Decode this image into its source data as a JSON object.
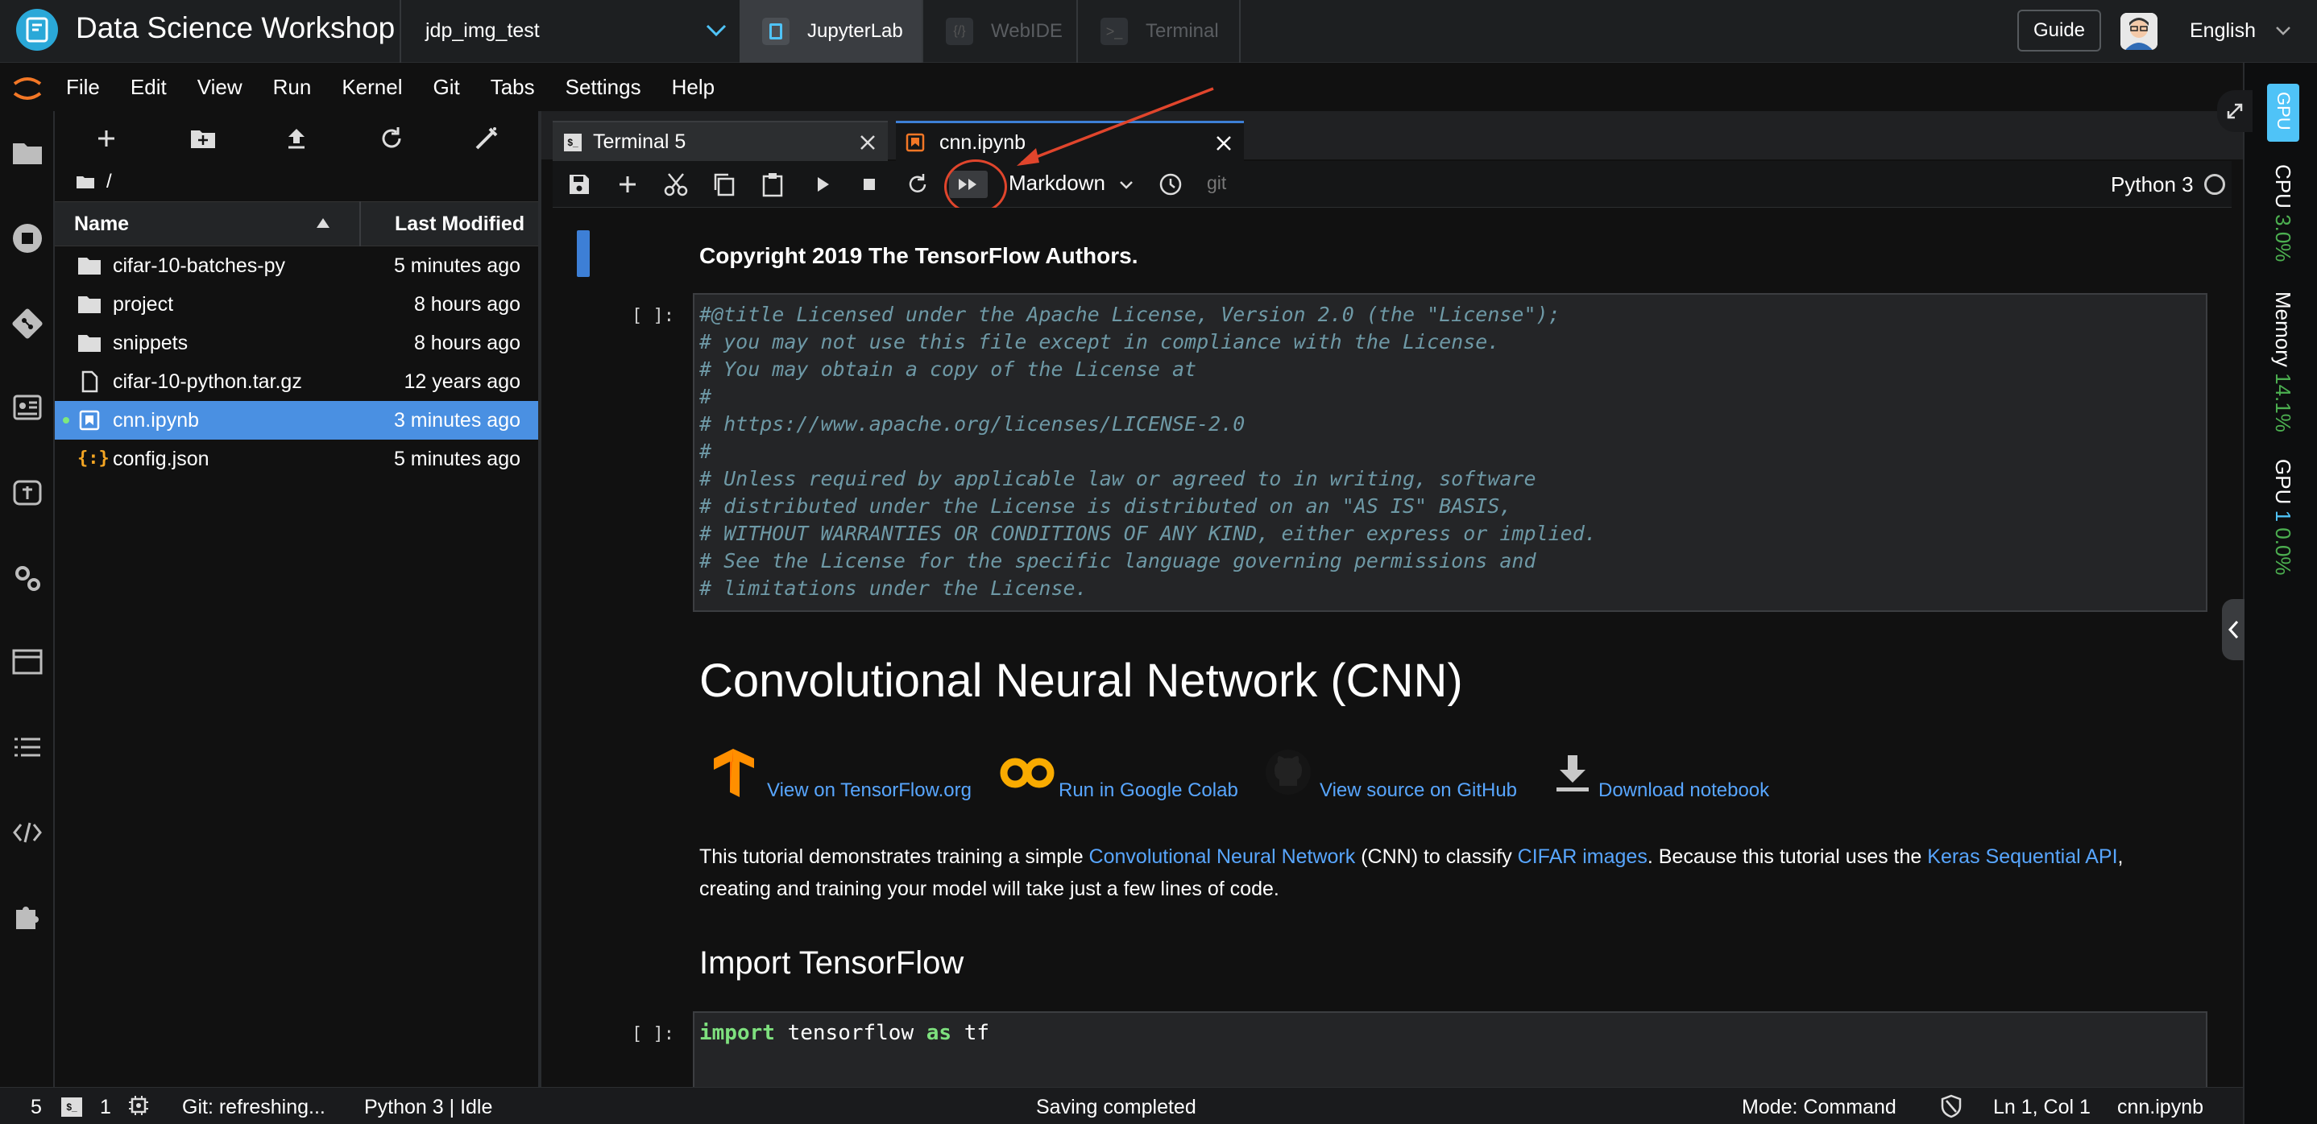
{
  "header": {
    "app_title": "Data Science Workshop",
    "project_name": "jdp_img_test",
    "app_tabs": [
      {
        "label": "JupyterLab",
        "active": true
      },
      {
        "label": "WebIDE",
        "active": false
      },
      {
        "label": "Terminal",
        "active": false
      }
    ],
    "guide_label": "Guide",
    "language": "English"
  },
  "menu": [
    "File",
    "Edit",
    "View",
    "Run",
    "Kernel",
    "Git",
    "Tabs",
    "Settings",
    "Help"
  ],
  "file_browser": {
    "breadcrumb": "/",
    "col_name": "Name",
    "col_modified": "Last Modified",
    "files": [
      {
        "name": "cifar-10-batches-py",
        "modified": "5 minutes ago",
        "icon": "folder-icon",
        "selected": false
      },
      {
        "name": "project",
        "modified": "8 hours ago",
        "icon": "folder-icon",
        "selected": false
      },
      {
        "name": "snippets",
        "modified": "8 hours ago",
        "icon": "folder-icon",
        "selected": false
      },
      {
        "name": "cifar-10-python.tar.gz",
        "modified": "12 years ago",
        "icon": "file-icon",
        "selected": false
      },
      {
        "name": "cnn.ipynb",
        "modified": "3 minutes ago",
        "icon": "notebook-icon",
        "selected": true
      },
      {
        "name": "config.json",
        "modified": "5 minutes ago",
        "icon": "json-icon",
        "selected": false
      }
    ]
  },
  "doc_tabs": [
    {
      "label": "Terminal 5",
      "active": false
    },
    {
      "label": "cnn.ipynb",
      "active": true
    }
  ],
  "toolbar": {
    "cell_type": "Markdown",
    "git_label": "git",
    "kernel_name": "Python 3"
  },
  "notebook": {
    "copyright": "Copyright 2019 The TensorFlow Authors.",
    "prompt": "[ ]:",
    "license_lines": [
      "#@title Licensed under the Apache License, Version 2.0 (the \"License\");",
      "# you may not use this file except in compliance with the License.",
      "# You may obtain a copy of the License at",
      "#",
      "# https://www.apache.org/licenses/LICENSE-2.0",
      "#",
      "# Unless required by applicable law or agreed to in writing, software",
      "# distributed under the License is distributed on an \"AS IS\" BASIS,",
      "# WITHOUT WARRANTIES OR CONDITIONS OF ANY KIND, either express or implied.",
      "# See the License for the specific language governing permissions and",
      "# limitations under the License."
    ],
    "h1": "Convolutional Neural Network (CNN)",
    "links": {
      "tf": "View on TensorFlow.org",
      "colab": "Run in Google Colab",
      "github": "View source on GitHub",
      "download": "Download notebook"
    },
    "para": {
      "t1": "This tutorial demonstrates training a simple ",
      "l1": "Convolutional Neural Network",
      "t2": " (CNN) to classify ",
      "l2": "CIFAR images",
      "t3": ". Because this tutorial uses the ",
      "l3": "Keras Sequential API",
      "t4": ",",
      "line2": "creating and training your model will take just a few lines of code."
    },
    "h2": "Import TensorFlow",
    "code2": {
      "kw1": "import",
      "mod": " tensorflow ",
      "kw2": "as",
      "alias": " tf"
    }
  },
  "right_panel": {
    "gpu_badge": "GPU",
    "cpu_label": "CPU",
    "cpu_value": "3.0%",
    "mem_label": "Memory",
    "mem_value": "14.1%",
    "gpu_label": "GPU",
    "gpu_count": "1",
    "gpu_value": "0.0%"
  },
  "status": {
    "count1": "5",
    "count2": "1",
    "git": "Git: refreshing...",
    "kernel": "Python 3 | Idle",
    "saving": "Saving completed",
    "mode": "Mode: Command",
    "position": "Ln 1, Col 1",
    "file": "cnn.ipynb"
  },
  "colors": {
    "accent": "#4a90e2",
    "brand": "#2aa8d8",
    "annotation": "#e0452c",
    "link": "#58a6ff",
    "metric": "#4caf50"
  }
}
